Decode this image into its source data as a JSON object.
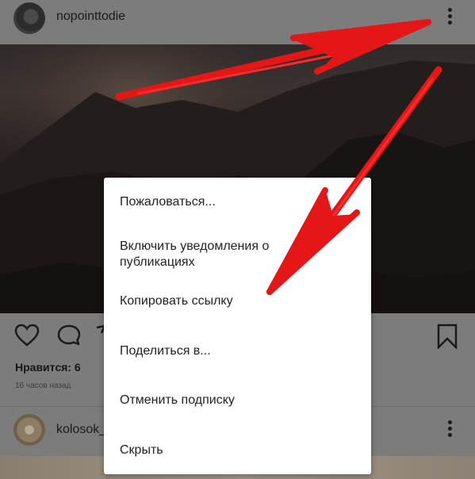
{
  "post": {
    "username": "nopointtodie",
    "likes": "Нравится: 6",
    "time": "16 часов назад"
  },
  "next_post": {
    "username": "kolosok_"
  },
  "menu": {
    "items": [
      {
        "label": "Пожаловаться..."
      },
      {
        "label_line1": "Включить уведомления о",
        "label_line2": "публикациях"
      },
      {
        "label": "Копировать ссылку"
      },
      {
        "label": "Поделиться в..."
      },
      {
        "label": "Отменить подписку"
      },
      {
        "label": "Скрыть"
      }
    ]
  },
  "icons": [
    "more-options-icon",
    "heart-icon",
    "comment-icon",
    "share-icon",
    "bookmark-icon"
  ],
  "colors": {
    "overlay": "#7c7c7c",
    "menu_bg": "#ffffff",
    "arrow": "#e41616"
  }
}
